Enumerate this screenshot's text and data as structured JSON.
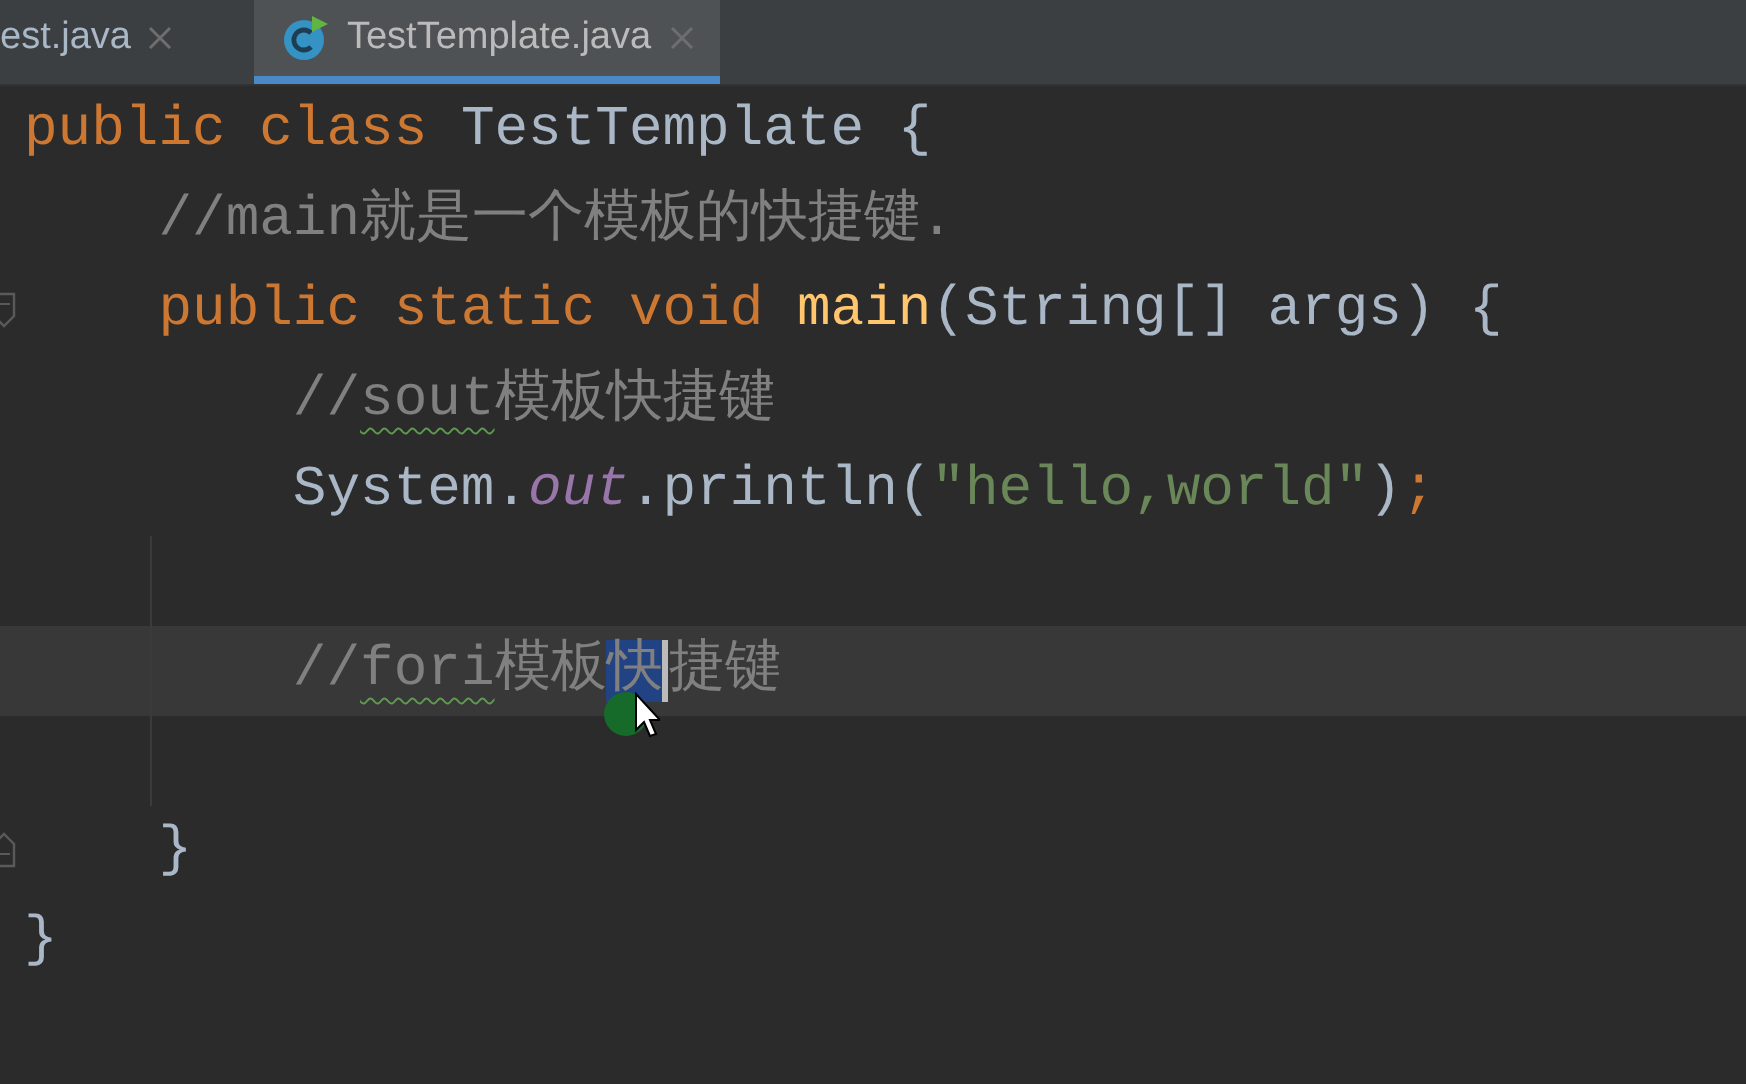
{
  "tabs": [
    {
      "label": "est.java",
      "selected": false,
      "icon": false
    },
    {
      "label": "TestTemplate.java",
      "selected": true,
      "icon": true
    }
  ],
  "editor": {
    "lines": [
      {
        "current": false,
        "guide": false,
        "tokens": [
          {
            "text": "public class ",
            "kind": "keyword"
          },
          {
            "text": "TestTemplate {",
            "kind": "plain"
          }
        ]
      },
      {
        "current": false,
        "guide": false,
        "tokens": [
          {
            "text": "    //main就是一个模板的快捷键.",
            "kind": "comment"
          }
        ]
      },
      {
        "current": false,
        "guide": false,
        "gutter": {
          "kind": "fold_start"
        },
        "tokens": [
          {
            "text": "    public static void ",
            "kind": "keyword"
          },
          {
            "text": "main",
            "kind": "method"
          },
          {
            "text": "(String[] args) {",
            "kind": "plain"
          }
        ]
      },
      {
        "current": false,
        "guide": false,
        "tokens": [
          {
            "text": "        //",
            "kind": "comment"
          },
          {
            "text": "sout",
            "kind": "typo"
          },
          {
            "text": "模板快捷键",
            "kind": "comment"
          }
        ]
      },
      {
        "current": false,
        "guide": false,
        "tokens": [
          {
            "text": "        System.",
            "kind": "plain"
          },
          {
            "text": "out",
            "kind": "field"
          },
          {
            "text": ".println(",
            "kind": "plain"
          },
          {
            "text": "\"hello,world\"",
            "kind": "string"
          },
          {
            "text": ")",
            "kind": "plain"
          },
          {
            "text": ";",
            "kind": "keyword"
          }
        ]
      },
      {
        "current": false,
        "guide": true
      },
      {
        "current": true,
        "guide": true,
        "tokens": [
          {
            "text": "        //",
            "kind": "comment"
          },
          {
            "text": "fori",
            "kind": "typo"
          },
          {
            "text": "模板",
            "kind": "comment"
          },
          {
            "text": "快",
            "kind": "selection"
          },
          {
            "text": "捷键",
            "kind": "comment"
          }
        ]
      },
      {
        "current": false,
        "guide": true
      },
      {
        "current": false,
        "guide": false,
        "gutter": {
          "kind": "fold_end"
        },
        "tokens": [
          {
            "text": "    }",
            "kind": "plain"
          }
        ]
      },
      {
        "current": false,
        "guide": false,
        "tokens": [
          {
            "text": "}",
            "kind": "plain"
          }
        ]
      }
    ]
  }
}
